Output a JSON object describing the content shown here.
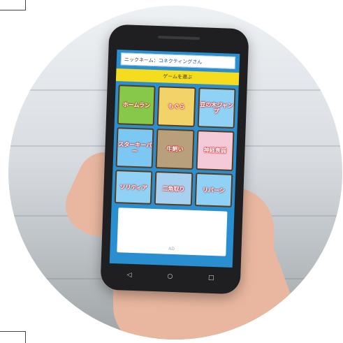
{
  "screen": {
    "nickname_label": "ニックネーム：",
    "nickname_value": "コネクティングさん",
    "section_title": "ゲームを選ぶ",
    "ad_label": "AD"
  },
  "games": [
    {
      "label": "ホームラン",
      "bg": "#86c94a"
    },
    {
      "label": "もぐら",
      "bg": "#f1d36a"
    },
    {
      "label": "豆の木ジャンプ",
      "bg": "#8fd2f5"
    },
    {
      "label": "スターキーパー",
      "bg": "#7cc8f2"
    },
    {
      "label": "牛飼い",
      "bg": "#b8a07a"
    },
    {
      "label": "神経衰弱",
      "bg": "#f4c9d8"
    },
    {
      "label": "ソリティア",
      "bg": "#8fd2f5"
    },
    {
      "label": "二角取り",
      "bg": "#a8d0f0"
    },
    {
      "label": "リバーシ",
      "bg": "#8fd2f5"
    }
  ],
  "nav": {
    "back": "◁",
    "home": "○",
    "recent": "□"
  },
  "colors": {
    "header_yellow": "#f5dc1f",
    "screen_blue": "#2a8fd1"
  }
}
